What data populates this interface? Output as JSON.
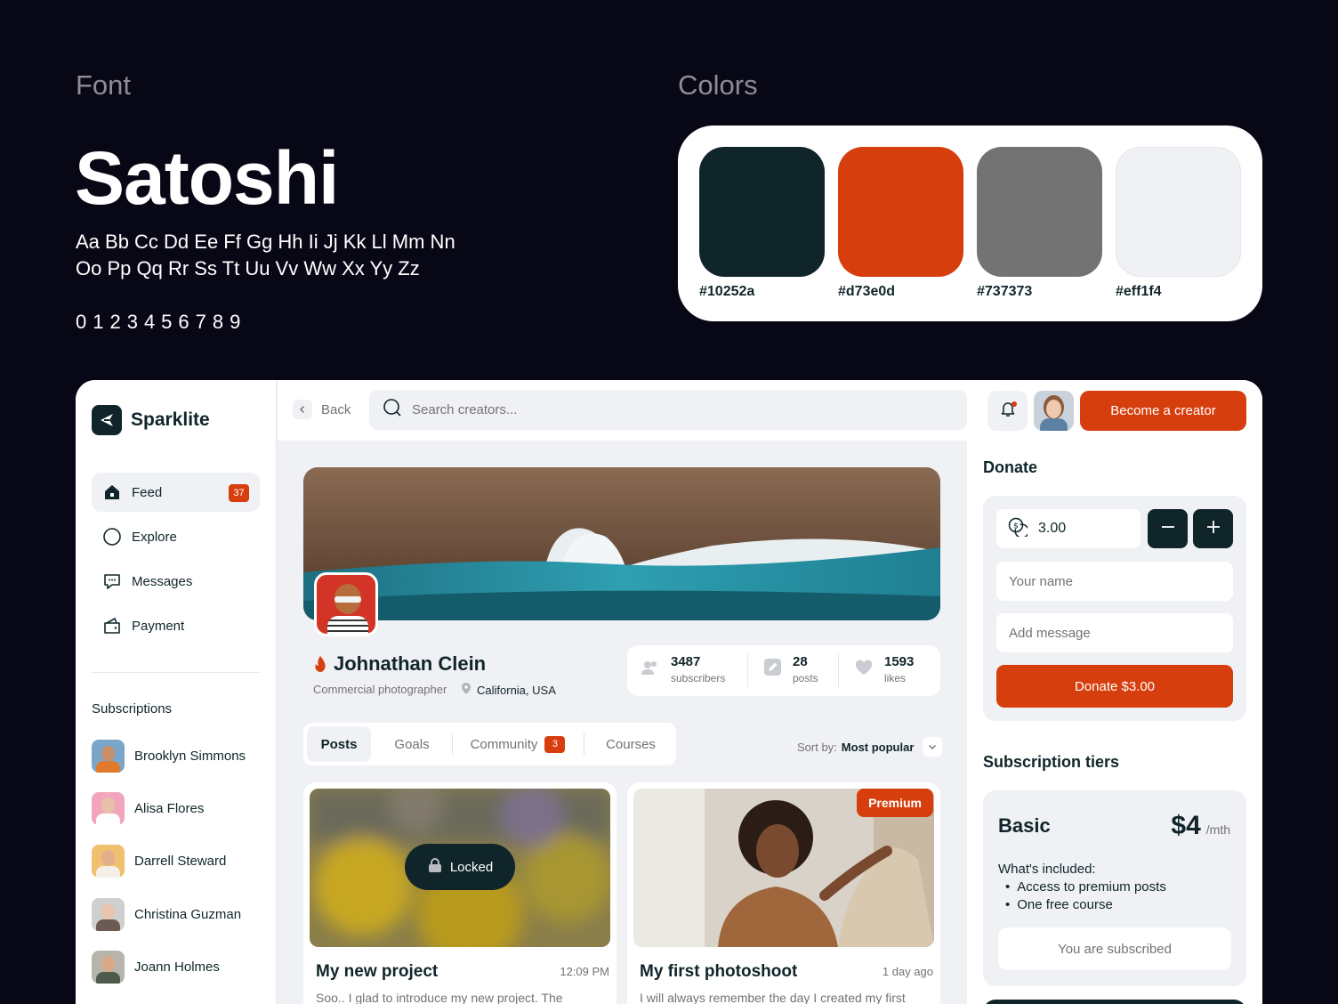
{
  "styleguide": {
    "font_heading": "Font",
    "colors_heading": "Colors",
    "font_name": "Satoshi",
    "alphabet_line1": "Aa Bb Cc Dd Ee Ff Gg Hh Ii Jj Kk Ll Mm Nn",
    "alphabet_line2": "Oo Pp Qq Rr Ss Tt Uu Vv Ww Xx Yy Zz",
    "digits": "0123456789",
    "colors": [
      {
        "label": "#10252a",
        "hex": "#10252a"
      },
      {
        "label": "#d73e0d",
        "hex": "#d73e0d"
      },
      {
        "label": "#737373",
        "hex": "#737373"
      },
      {
        "label": "#eff1f4",
        "hex": "#eff1f4"
      }
    ]
  },
  "app": {
    "brand": "Sparklite",
    "nav": [
      {
        "label": "Feed",
        "icon": "home-icon",
        "badge": "37",
        "active": true
      },
      {
        "label": "Explore",
        "icon": "compass-icon"
      },
      {
        "label": "Messages",
        "icon": "chat-icon"
      },
      {
        "label": "Payment",
        "icon": "wallet-icon"
      }
    ],
    "subscriptions_title": "Subscriptions",
    "subscriptions": [
      {
        "name": "Brooklyn Simmons"
      },
      {
        "name": "Alisa Flores"
      },
      {
        "name": "Darrell Steward"
      },
      {
        "name": "Christina Guzman"
      },
      {
        "name": "Joann Holmes"
      }
    ],
    "topbar": {
      "back_label": "Back",
      "search_placeholder": "Search creators...",
      "become_creator_label": "Become a creator"
    },
    "profile": {
      "name": "Johnathan Clein",
      "role": "Commercial photographer",
      "location": "California, USA",
      "stats": [
        {
          "value": "3487",
          "label": "subscribers",
          "icon": "users-icon"
        },
        {
          "value": "28",
          "label": "posts",
          "icon": "edit-icon"
        },
        {
          "value": "1593",
          "label": "likes",
          "icon": "heart-icon"
        }
      ]
    },
    "tabs": [
      {
        "label": "Posts",
        "active": true
      },
      {
        "label": "Goals"
      },
      {
        "label": "Community",
        "badge": "3"
      },
      {
        "label": "Courses"
      }
    ],
    "sort": {
      "label": "Sort by:",
      "value": "Most popular"
    },
    "posts": [
      {
        "title": "My new project",
        "time": "12:09 PM",
        "excerpt": "Soo.. I glad to introduce my new project. The",
        "overlay": "Locked"
      },
      {
        "title": "My first photoshoot",
        "time": "1 day ago",
        "excerpt": "I will always remember the day I created my first",
        "tag": "Premium"
      }
    ],
    "donate": {
      "title": "Donate",
      "amount": "3.00",
      "name_placeholder": "Your name",
      "message_placeholder": "Add message",
      "button_label": "Donate $3.00"
    },
    "tiers": {
      "title": "Subscription tiers",
      "items": [
        {
          "name": "Basic",
          "price": "$4",
          "unit": "/mth",
          "included_label": "What's included:",
          "features": [
            "Access to premium posts",
            "One free course"
          ],
          "button_label": "You are subscribed"
        }
      ]
    }
  }
}
